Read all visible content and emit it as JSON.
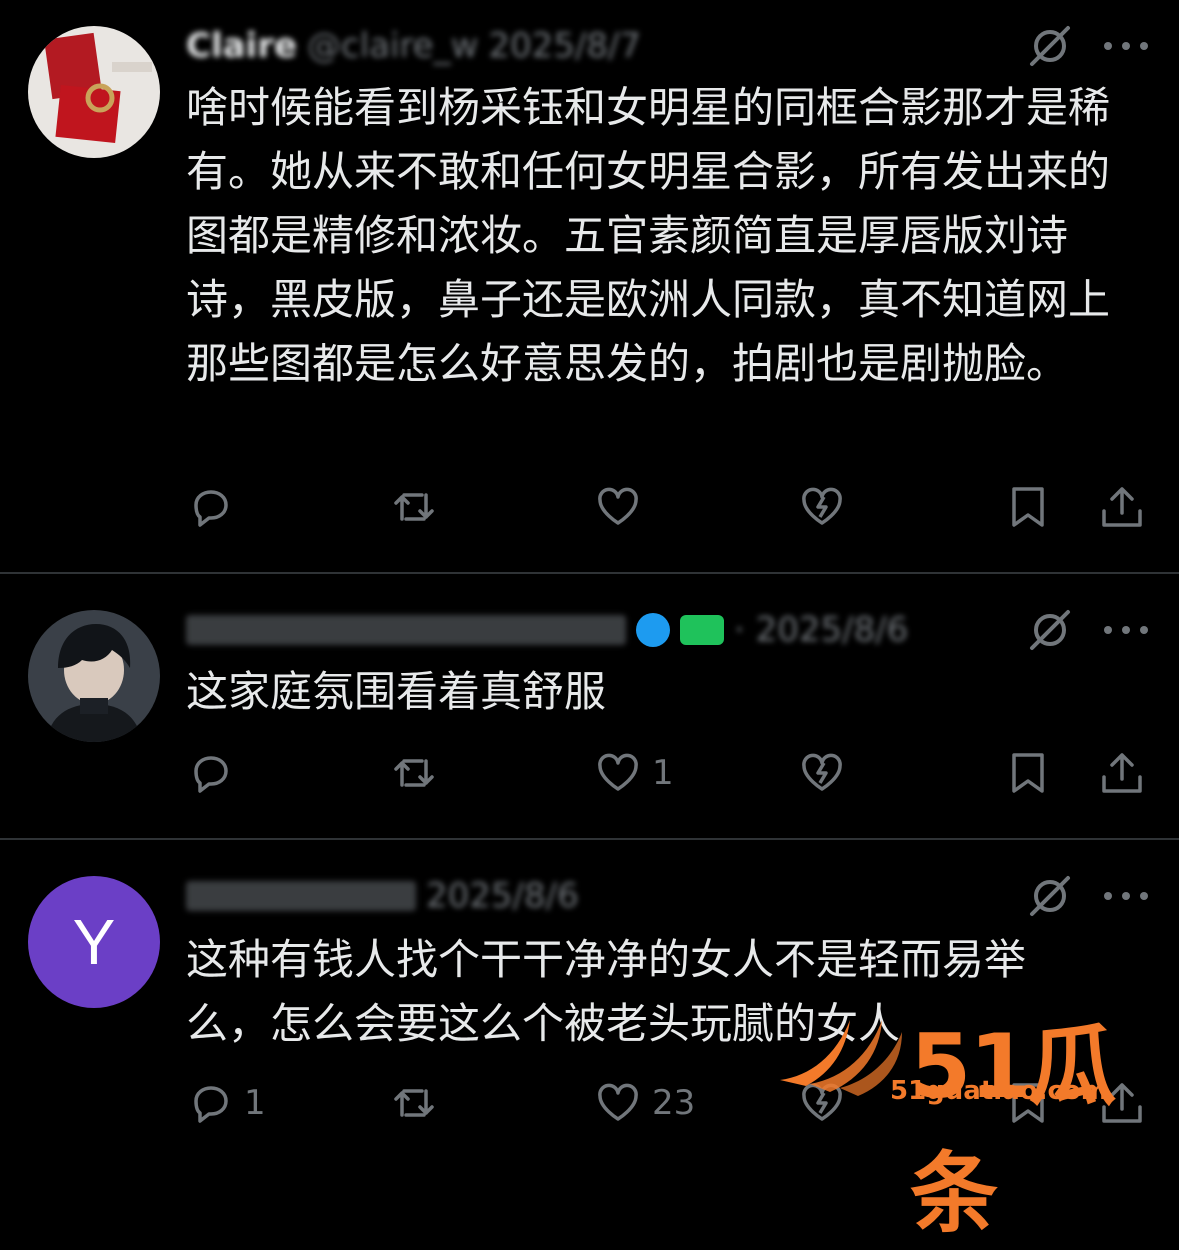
{
  "replies": [
    {
      "author_name": "Claire",
      "handle": "@claire_w",
      "date": "2025/8/7",
      "text": "啥时候能看到杨采钰和女明星的同框合影那才是稀有。她从来不敢和任何女明星合影，所有发出来的图都是精修和浓妆。五官素颜简直是厚唇版刘诗诗，黑皮版，鼻子还是欧洲人同款，真不知道网上那些图都是怎么好意思发的，拍剧也是剧抛脸。",
      "reply_count": "",
      "like_count": ""
    },
    {
      "author_name": "",
      "handle": "",
      "date": "· 2025/8/6",
      "text": "这家庭氛围看着真舒服",
      "reply_count": "",
      "like_count": "1"
    },
    {
      "author_name": "",
      "handle": "",
      "date": "2025/8/6",
      "avatar_letter": "Y",
      "text": "这种有钱人找个干干净净的女人不是轻而易举么，怎么会要这么个被老头玩腻的女人",
      "reply_count": "1",
      "like_count": "23"
    }
  ],
  "icons": [
    "reply-icon",
    "retweet-icon",
    "like-icon",
    "dislike-icon",
    "bookmark-icon",
    "share-icon",
    "grok-icon",
    "more-icon"
  ],
  "watermark": {
    "title": "51瓜条",
    "url": "51guatiao.com"
  },
  "colors": {
    "background": "#000000",
    "text": "#e7e9ea",
    "muted": "#71767b",
    "divider": "#2f3336",
    "avatar_purple": "#6b3fc6",
    "watermark": "#f37a2a"
  }
}
